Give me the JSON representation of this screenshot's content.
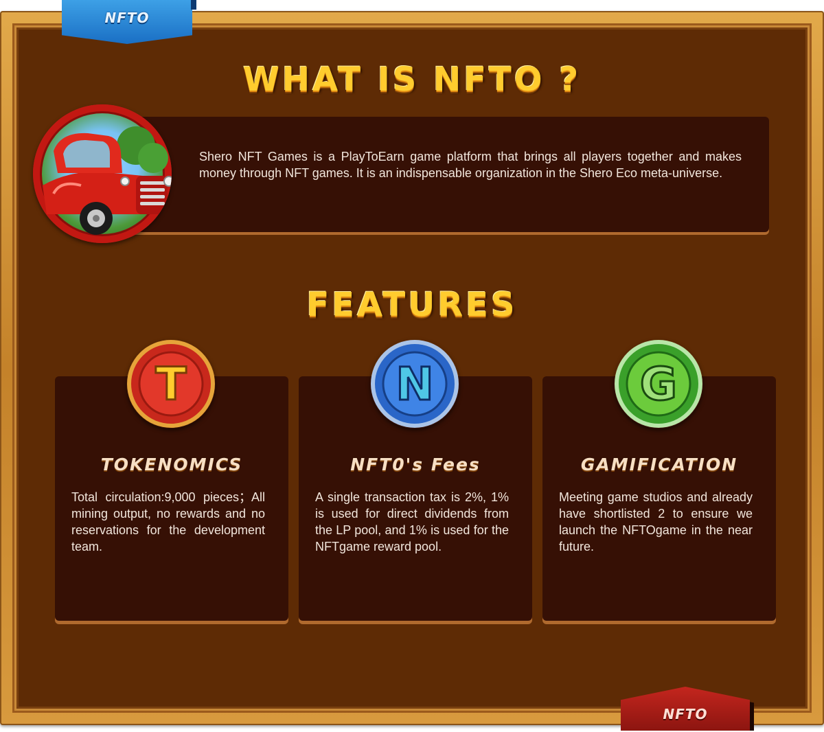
{
  "ribbon_top": {
    "label": "NFTO"
  },
  "ribbon_bottom": {
    "label": "NFTO"
  },
  "section_intro": {
    "heading": "WHAT IS NFTO ?",
    "text": "Shero NFT Games is a PlayToEarn game platform that brings all players together and makes money through NFT games. It is an indispensable organization in the Shero Eco meta-universe."
  },
  "section_features": {
    "heading": "FEATURES",
    "cards": [
      {
        "letter": "T",
        "title": "TOKENOMICS",
        "text": "Total circulation:9,000 pieces；All mining output, no rewards and no reservations for the development team.",
        "coin_color": "#c8281c"
      },
      {
        "letter": "N",
        "title": "NFT0's Fees",
        "text": "A single transaction tax is 2%, 1% is used for direct dividends from the LP pool, and 1% is used for the NFTgame reward pool.",
        "coin_color": "#2a66c8"
      },
      {
        "letter": "G",
        "title": "GAMIFICATION",
        "text": "Meeting game studios and already have shortlisted 2 to ensure we launch the NFTOgame in the near future.",
        "coin_color": "#3aa02a"
      }
    ]
  },
  "colors": {
    "board": "#5e2b05",
    "panel": "#361005",
    "frame_wood": "#d89a3e",
    "heading_gold": "#ffcc2e",
    "ribbon_blue": "#1a6fc4",
    "ribbon_red": "#8c1510"
  },
  "icons": [
    "red-truck-icon",
    "t-coin-icon",
    "n-coin-icon",
    "g-coin-icon"
  ]
}
